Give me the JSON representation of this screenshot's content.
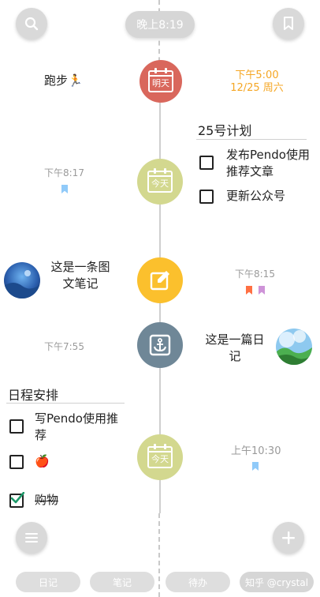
{
  "header": {
    "current_time": "晚上8:19"
  },
  "entries": {
    "run": {
      "text": "跑步🏃",
      "node_label": "明天",
      "time": "下午5:00",
      "date": "12/25 周六"
    },
    "plan": {
      "title": "25号计划",
      "todos": [
        {
          "label_line1": "发布Pendo使用",
          "label_line2": "推荐文章",
          "checked": false
        },
        {
          "label_line1": "更新公众号",
          "label_line2": "",
          "checked": false
        }
      ],
      "time": "下午8:17",
      "node_label": "今天"
    },
    "photo_note": {
      "text_line1": "这是一条图",
      "text_line2": "文笔记",
      "time": "下午8:15"
    },
    "diary": {
      "text_line1": "这是一篇日",
      "text_line2": "记",
      "time": "下午7:55"
    },
    "schedule": {
      "title": "日程安排",
      "todos": [
        {
          "label_line1": "写Pendo使用推",
          "label_line2": "荐",
          "checked": false
        },
        {
          "label_line1": "🍎",
          "label_line2": "",
          "checked": false
        },
        {
          "label_line1": "购物",
          "label_line2": "",
          "checked": true
        }
      ],
      "node_label": "今天",
      "time": "上午10:30"
    }
  },
  "tabs": [
    "日记",
    "笔记",
    "待办",
    "知乎 @crystal"
  ],
  "colors": {
    "tomorrow_node": "#d9675c",
    "today_node": "#d3d88f",
    "note_node": "#fbc02d",
    "diary_node": "#6f8797",
    "accent_orange": "#f5a623",
    "bookmark_blue": "#90caf9",
    "bookmark_orange": "#ff7043",
    "bookmark_purple": "#ce93d8"
  },
  "icons": [
    "search-icon",
    "bookmark-icon",
    "calendar-icon",
    "edit-icon",
    "anchor-icon",
    "menu-icon",
    "plus-icon"
  ]
}
